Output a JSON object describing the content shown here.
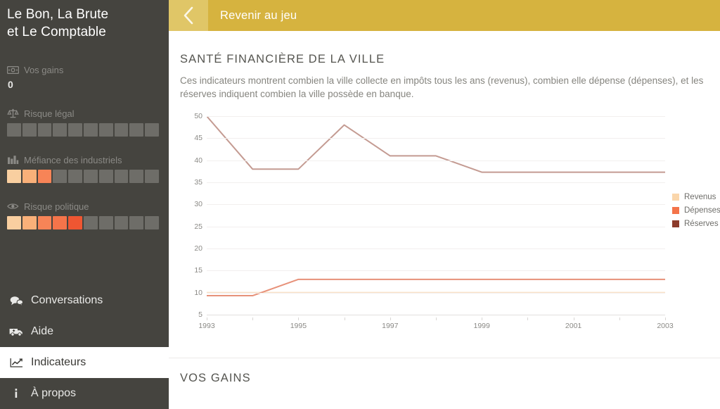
{
  "sidebar": {
    "title": "Le Bon, La Brute\net Le Comptable",
    "title_line1": "Le Bon, La Brute",
    "title_line2": "et Le Comptable",
    "stats": [
      {
        "label": "Vos gains",
        "icon": "banknote-icon",
        "value": "0",
        "has_value": true,
        "has_gauge": false,
        "filled": 0,
        "total": 10
      },
      {
        "label": "Risque légal",
        "icon": "scales-icon",
        "value": "",
        "has_value": false,
        "has_gauge": true,
        "filled": 0,
        "total": 10
      },
      {
        "label": "Méfiance des industriels",
        "icon": "factory-icon",
        "value": "",
        "has_value": false,
        "has_gauge": true,
        "filled": 3,
        "total": 10
      },
      {
        "label": "Risque politique",
        "icon": "eye-icon",
        "value": "",
        "has_value": false,
        "has_gauge": true,
        "filled": 5,
        "total": 10
      }
    ],
    "menu": [
      {
        "label": "Conversations",
        "icon": "chat-bubbles-icon",
        "active": false
      },
      {
        "label": "Aide",
        "icon": "ambulance-icon",
        "active": false
      },
      {
        "label": "Indicateurs",
        "icon": "line-chart-icon",
        "active": true
      },
      {
        "label": "À propos",
        "icon": "info-icon",
        "active": false
      }
    ]
  },
  "topbar": {
    "back_icon": "chevron-left-icon",
    "back_label": "Revenir au jeu",
    "bg_color": "#d6b33f",
    "back_btn_color": "#e0c667"
  },
  "main": {
    "section_title": "SANTÉ FINANCIÈRE DE LA VILLE",
    "section_desc": "Ces indicateurs montrent combien la ville collecte en impôts tous les ans (revenus), combien elle dépense (dépenses), et les réserves indiquent combien la ville possède en banque.",
    "gains_title": "VOS GAINS"
  },
  "colors": {
    "revenus": "#fad6ab",
    "depenses": "#f4744a",
    "reserves": "#8c3b2b",
    "reserves_line": "#c49b92",
    "depenses_line": "#e79179",
    "revenus_line": "#fae2c8",
    "sidebar_bg": "#45443f",
    "gauge_empty": "#6e6d68",
    "gold": "#d6b33f"
  },
  "chart_data": {
    "type": "line",
    "title": "",
    "xlabel": "",
    "ylabel": "",
    "x": [
      1993,
      1994,
      1995,
      1996,
      1997,
      1998,
      1999,
      2000,
      2001,
      2002,
      2003
    ],
    "xlim": [
      1993,
      2003
    ],
    "ylim": [
      5,
      50
    ],
    "yticks": [
      5,
      10,
      15,
      20,
      25,
      30,
      35,
      40,
      45,
      50
    ],
    "xticks": [
      1993,
      1995,
      1997,
      1999,
      2001,
      2003
    ],
    "grid": true,
    "legend_position": "right",
    "series": [
      {
        "name": "Revenus",
        "color": "#fad6ab",
        "values": [
          10,
          10,
          10,
          10,
          10,
          10,
          10,
          10,
          10,
          10,
          10
        ]
      },
      {
        "name": "Dépenses",
        "color": "#f4744a",
        "values": [
          9.3,
          9.3,
          13,
          13,
          13,
          13,
          13,
          13,
          13,
          13,
          13
        ]
      },
      {
        "name": "Réserves",
        "color": "#8c3b2b",
        "values": [
          50,
          38,
          38,
          48,
          41,
          41,
          37.3,
          37.3,
          37.3,
          37.3,
          37.3
        ]
      }
    ]
  }
}
